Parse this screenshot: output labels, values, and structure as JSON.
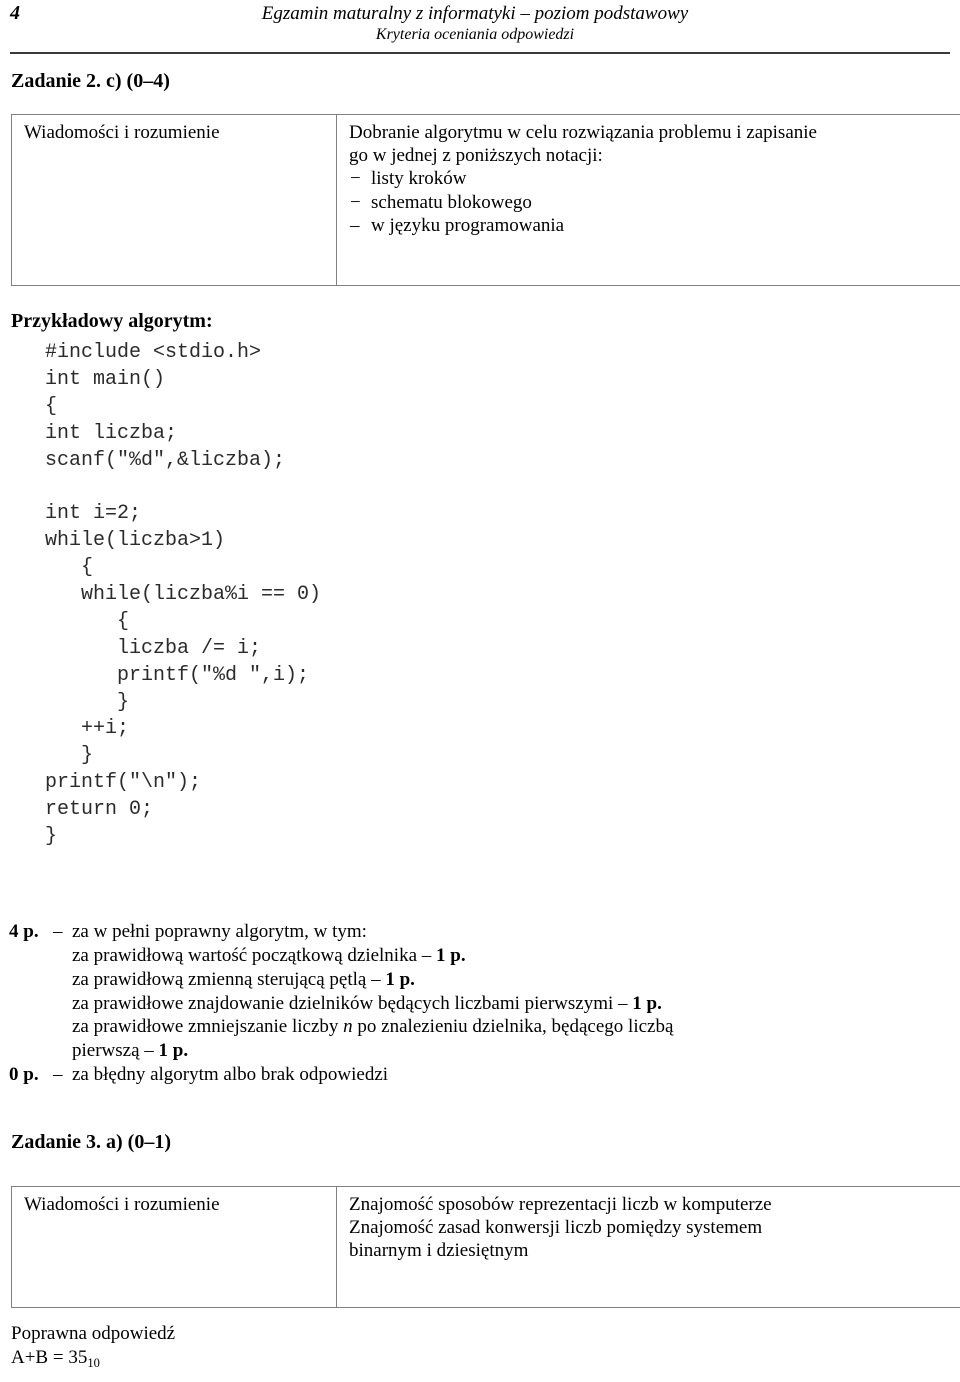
{
  "header": {
    "page_number": "4",
    "line1": "Egzamin maturalny z informatyki – poziom podstawowy",
    "line2": "Kryteria oceniania odpowiedzi"
  },
  "task2": {
    "heading": "Zadanie 2. c) (0–4)",
    "table": {
      "category": "Wiadomości i rozumienie",
      "description_line1": "Dobranie algorytmu w celu rozwiązania problemu i zapisanie",
      "description_line2": "go w jednej z poniższych notacji:",
      "notations": [
        {
          "dash": "−",
          "label": "listy kroków"
        },
        {
          "dash": "−",
          "label": "schematu blokowego"
        },
        {
          "dash": "–",
          "label": "w języku programowania"
        }
      ]
    },
    "algorithm_label": "Przykładowy algorytm:",
    "algorithm_code": "#include <stdio.h>\nint main()\n{\nint liczba;\nscanf(\"%d\",&liczba);\n\nint i=2;\nwhile(liczba>1)\n   {\n   while(liczba%i == 0)\n      {\n      liczba /= i;\n      printf(\"%d \",i);\n      }\n   ++i;\n   }\nprintf(\"\\n\");\nreturn 0;\n}",
    "scoring": [
      {
        "points": "4 p.",
        "lead": "–",
        "lines": [
          {
            "text": "za w pełni poprawny algorytm, w tym:",
            "justify": false,
            "points_suffix": ""
          },
          {
            "text": "za prawidłową wartość początkową dzielnika – ",
            "justify": false,
            "points_suffix": "1 p."
          },
          {
            "text": "za prawidłową zmienną sterującą pętlą – ",
            "justify": false,
            "points_suffix": "1 p."
          },
          {
            "text": "za prawidłowe znajdowanie dzielników będących liczbami pierwszymi – ",
            "justify": false,
            "points_suffix": "1 p."
          },
          {
            "text_pre": "za prawidłowe zmniejszanie liczby ",
            "italic": "n",
            "text_post": " po znalezieniu dzielnika, będącego liczbą",
            "justify": true,
            "points_suffix": ""
          },
          {
            "text": "pierwszą – ",
            "justify": false,
            "points_suffix": "1 p."
          }
        ]
      },
      {
        "points": "0 p.",
        "lead": "–",
        "lines": [
          {
            "text": "za błędny algorytm albo brak odpowiedzi",
            "justify": false,
            "points_suffix": ""
          }
        ]
      }
    ]
  },
  "task3": {
    "heading": "Zadanie 3. a) (0–1)",
    "table": {
      "category": "Wiadomości i rozumienie",
      "description_line1": "Znajomość sposobów reprezentacji liczb w komputerze",
      "description_line2": "Znajomość zasad konwersji liczb pomiędzy systemem",
      "description_line3": "binarnym i dziesiętnym"
    },
    "answer_label": "Poprawna odpowiedź",
    "answer_value": "A+B = 35",
    "answer_subscript": "10"
  }
}
